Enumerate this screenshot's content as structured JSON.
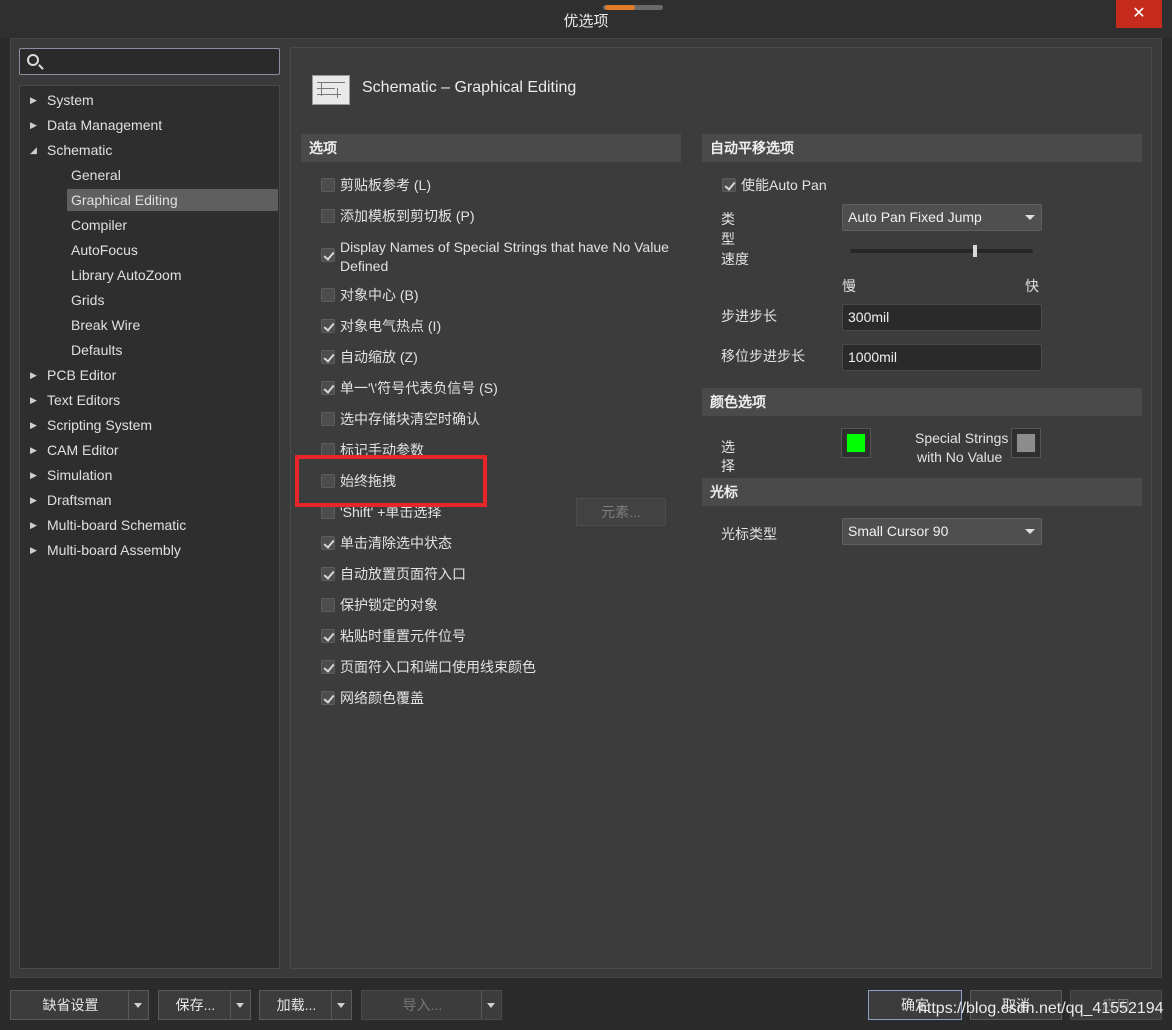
{
  "window": {
    "title": "优选项",
    "close_label": "✕"
  },
  "tree": {
    "items": [
      {
        "label": "System"
      },
      {
        "label": "Data Management"
      },
      {
        "label": "Schematic"
      },
      {
        "label": "General"
      },
      {
        "label": "Graphical Editing"
      },
      {
        "label": "Compiler"
      },
      {
        "label": "AutoFocus"
      },
      {
        "label": "Library AutoZoom"
      },
      {
        "label": "Grids"
      },
      {
        "label": "Break Wire"
      },
      {
        "label": "Defaults"
      },
      {
        "label": "PCB Editor"
      },
      {
        "label": "Text Editors"
      },
      {
        "label": "Scripting System"
      },
      {
        "label": "CAM Editor"
      },
      {
        "label": "Simulation"
      },
      {
        "label": "Draftsman"
      },
      {
        "label": "Multi-board Schematic"
      },
      {
        "label": "Multi-board Assembly"
      }
    ]
  },
  "page": {
    "title": "Schematic – Graphical Editing"
  },
  "options": {
    "header": "选项",
    "items": [
      {
        "label": "剪贴板参考 (L)",
        "checked": false
      },
      {
        "label": "添加模板到剪切板 (P)",
        "checked": false
      },
      {
        "label": "Display Names of Special Strings that have No Value",
        "label2": "Defined",
        "checked": true
      },
      {
        "label": "对象中心 (B)",
        "checked": false
      },
      {
        "label": "对象电气热点 (I)",
        "checked": true
      },
      {
        "label": "自动缩放 (Z)",
        "checked": true
      },
      {
        "label": "单一'\\'符号代表负信号 (S)",
        "checked": true
      },
      {
        "label": "选中存储块清空时确认",
        "checked": false
      },
      {
        "label": "标记手动参数",
        "checked": false
      },
      {
        "label": "始终拖拽",
        "checked": false
      },
      {
        "label": "'Shift' +单击选择",
        "checked": false
      },
      {
        "label": "单击清除选中状态",
        "checked": true
      },
      {
        "label": "自动放置页面符入口",
        "checked": true
      },
      {
        "label": "保护锁定的对象",
        "checked": false
      },
      {
        "label": "粘贴时重置元件位号",
        "checked": true
      },
      {
        "label": "页面符入口和端口使用线束颜色",
        "checked": true
      },
      {
        "label": "网络颜色覆盖",
        "checked": true
      }
    ],
    "elements_button": "元素..."
  },
  "autopan": {
    "header": "自动平移选项",
    "enable_label": "使能Auto Pan",
    "enable_checked": true,
    "type_label_1": "类",
    "type_label_2": "型",
    "type_value": "Auto Pan Fixed Jump",
    "speed_label": "速度",
    "speed_level": 0.7,
    "slow_label": "慢",
    "fast_label": "快",
    "step_label": "步进步长",
    "step_value": "300mil",
    "shift_step_label": "移位步进步长",
    "shift_step_value": "1000mil"
  },
  "color": {
    "header": "颜色选项",
    "select_label_1": "选",
    "select_label_2": "择",
    "select_color": "#00ff00",
    "special_label_1": "Special Strings",
    "special_label_2": "with No Value",
    "special_color": "#8c8c8c"
  },
  "cursor": {
    "header": "光标",
    "type_label": "光标类型",
    "type_value": "Small Cursor 90"
  },
  "footer": {
    "defaults": "缺省设置",
    "save": "保存...",
    "load": "加载...",
    "import": "导入...",
    "ok": "确定",
    "cancel": "取消",
    "apply": "应用"
  },
  "watermark": "https://blog.csdn.net/qq_41552194"
}
